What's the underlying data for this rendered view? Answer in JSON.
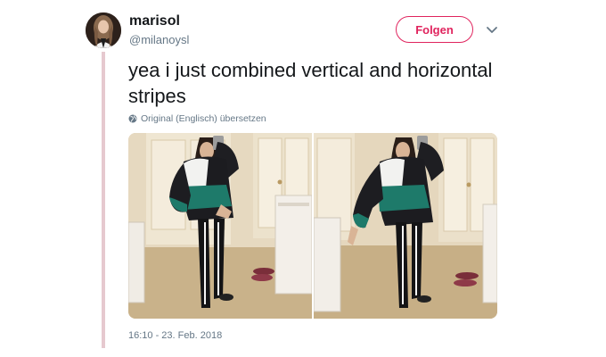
{
  "tweet": {
    "display_name": "marisol",
    "handle": "@milanoysl",
    "follow_label": "Folgen",
    "text": "yea i just combined vertical and horizontal stripes",
    "translate_label": "Original (Englisch) übersetzen",
    "timestamp": "16:10 - 23. Feb. 2018"
  },
  "colors": {
    "accent": "#e0245e",
    "secondary_text": "#657786",
    "thread_line": "#e6c9cf"
  },
  "icons": {
    "more": "chevron-down-icon",
    "translate": "globe-icon"
  },
  "media": {
    "count": 2
  }
}
